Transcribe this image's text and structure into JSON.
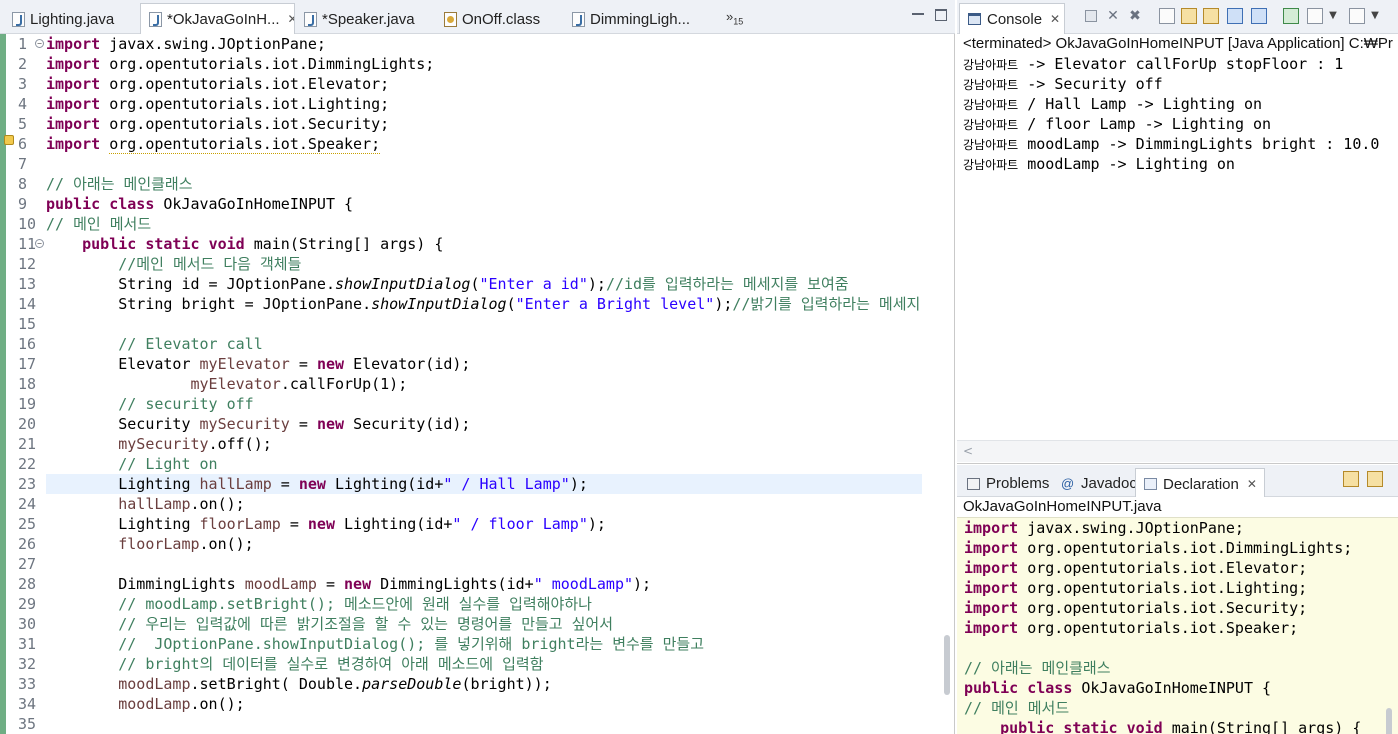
{
  "editor": {
    "tabs": [
      {
        "label": "Lighting.java",
        "icon": "java-file-icon",
        "active": false
      },
      {
        "label": "*OkJavaGoInH...",
        "icon": "java-file-icon",
        "active": true,
        "close": "✕"
      },
      {
        "label": "*Speaker.java",
        "icon": "java-file-icon",
        "active": false
      },
      {
        "label": "OnOff.class",
        "icon": "class-file-icon",
        "active": false
      },
      {
        "label": "DimmingLigh...",
        "icon": "java-file-icon",
        "active": false
      }
    ],
    "overflow_label": "»",
    "overflow_count": "15",
    "lines": [
      {
        "n": "1",
        "fold": "−",
        "segs": [
          [
            "kw",
            "import"
          ],
          [
            "",
            "javax.swing.JOptionPane;"
          ]
        ]
      },
      {
        "n": "2",
        "segs": [
          [
            "kw",
            "import"
          ],
          [
            "",
            "org.opentutorials.iot.DimmingLights;"
          ]
        ]
      },
      {
        "n": "3",
        "segs": [
          [
            "kw",
            "import"
          ],
          [
            "",
            "org.opentutorials.iot.Elevator;"
          ]
        ]
      },
      {
        "n": "4",
        "segs": [
          [
            "kw",
            "import"
          ],
          [
            "",
            "org.opentutorials.iot.Lighting;"
          ]
        ]
      },
      {
        "n": "5",
        "segs": [
          [
            "kw",
            "import"
          ],
          [
            "",
            "org.opentutorials.iot.Security;"
          ]
        ]
      },
      {
        "n": "6",
        "segs": [
          [
            "kw",
            "import"
          ],
          [
            "uline",
            "org.opentutorials.iot.Speaker;"
          ]
        ]
      },
      {
        "n": "7",
        "segs": []
      },
      {
        "n": "8",
        "segs": [
          [
            "cm",
            "// 아래는 메인클래스"
          ]
        ]
      },
      {
        "n": "9",
        "segs": [
          [
            "kw",
            "public"
          ],
          [
            "kw",
            "class"
          ],
          [
            "",
            "OkJavaGoInHomeINPUT {"
          ]
        ]
      },
      {
        "n": "10",
        "segs": [
          [
            "cm",
            "// 메인 메서드"
          ]
        ]
      },
      {
        "n": "11",
        "fold": "−",
        "indent": "    ",
        "segs": [
          [
            "kw",
            "public"
          ],
          [
            "kw",
            "static"
          ],
          [
            "kw",
            "void"
          ],
          [
            "",
            "main(String[] args) {"
          ]
        ]
      },
      {
        "n": "12",
        "indent": "        ",
        "segs": [
          [
            "cm",
            "//메인 메서드 다음 객체들"
          ]
        ]
      },
      {
        "n": "13",
        "indent": "        ",
        "segs": [
          [
            "",
            "String id = JOptionPane."
          ],
          [
            "it",
            "showInputDialog"
          ],
          [
            "",
            "("
          ],
          [
            "str",
            "\"Enter a id\""
          ],
          [
            "",
            ");"
          ],
          [
            "cm",
            "//id를 입력하라는 메세지를 보여줌"
          ]
        ]
      },
      {
        "n": "14",
        "indent": "        ",
        "segs": [
          [
            "",
            "String bright = JOptionPane."
          ],
          [
            "it",
            "showInputDialog"
          ],
          [
            "",
            "("
          ],
          [
            "str",
            "\"Enter a Bright level\""
          ],
          [
            "",
            ");"
          ],
          [
            "cm",
            "//밝기를 입력하라는 메세지"
          ]
        ]
      },
      {
        "n": "15",
        "segs": []
      },
      {
        "n": "16",
        "indent": "        ",
        "segs": [
          [
            "cm",
            "// Elevator call"
          ]
        ]
      },
      {
        "n": "17",
        "indent": "        ",
        "segs": [
          [
            "",
            "Elevator "
          ],
          [
            "fld",
            "myElevator"
          ],
          [
            "",
            " = "
          ],
          [
            "kw",
            "new"
          ],
          [
            "",
            "Elevator(id);"
          ]
        ]
      },
      {
        "n": "18",
        "indent": "                ",
        "segs": [
          [
            "fld",
            "myElevator"
          ],
          [
            "",
            ".callForUp(1);"
          ]
        ]
      },
      {
        "n": "19",
        "indent": "        ",
        "segs": [
          [
            "cm",
            "// security off"
          ]
        ]
      },
      {
        "n": "20",
        "indent": "        ",
        "segs": [
          [
            "",
            "Security "
          ],
          [
            "fld",
            "mySecurity"
          ],
          [
            "",
            " = "
          ],
          [
            "kw",
            "new"
          ],
          [
            "",
            "Security(id);"
          ]
        ]
      },
      {
        "n": "21",
        "indent": "        ",
        "segs": [
          [
            "fld",
            "mySecurity"
          ],
          [
            "",
            ".off();"
          ]
        ]
      },
      {
        "n": "22",
        "indent": "        ",
        "segs": [
          [
            "cm",
            "// Light on"
          ]
        ]
      },
      {
        "n": "23",
        "hl": true,
        "indent": "        ",
        "segs": [
          [
            "",
            "Lighting "
          ],
          [
            "fld",
            "hallLamp"
          ],
          [
            "",
            " = "
          ],
          [
            "kw",
            "new"
          ],
          [
            "",
            "Lighting(id+"
          ],
          [
            "str",
            "\" / Hall Lamp\""
          ],
          [
            "",
            ");"
          ]
        ]
      },
      {
        "n": "24",
        "indent": "        ",
        "segs": [
          [
            "fld",
            "hallLamp"
          ],
          [
            "",
            ".on();"
          ]
        ]
      },
      {
        "n": "25",
        "indent": "        ",
        "segs": [
          [
            "",
            "Lighting "
          ],
          [
            "fld",
            "floorLamp"
          ],
          [
            "",
            " = "
          ],
          [
            "kw",
            "new"
          ],
          [
            "",
            "Lighting(id+"
          ],
          [
            "str",
            "\" / floor Lamp\""
          ],
          [
            "",
            ");"
          ]
        ]
      },
      {
        "n": "26",
        "indent": "        ",
        "segs": [
          [
            "fld",
            "floorLamp"
          ],
          [
            "",
            ".on();"
          ]
        ]
      },
      {
        "n": "27",
        "segs": []
      },
      {
        "n": "28",
        "indent": "        ",
        "segs": [
          [
            "",
            "DimmingLights "
          ],
          [
            "fld",
            "moodLamp"
          ],
          [
            "",
            " = "
          ],
          [
            "kw",
            "new"
          ],
          [
            "",
            "DimmingLights(id+"
          ],
          [
            "str",
            "\" moodLamp\""
          ],
          [
            "",
            ");"
          ]
        ]
      },
      {
        "n": "29",
        "indent": "        ",
        "segs": [
          [
            "cm",
            "// moodLamp.setBright(); 메소드안에 원래 실수를 입력해야하나"
          ]
        ]
      },
      {
        "n": "30",
        "indent": "        ",
        "segs": [
          [
            "cm",
            "// 우리는 입력값에 따른 밝기조절을 할 수 있는 명령어를 만들고 싶어서"
          ]
        ]
      },
      {
        "n": "31",
        "indent": "        ",
        "segs": [
          [
            "cm",
            "//  JOptionPane.showInputDialog(); 를 넣기위해 bright라는 변수를 만들고"
          ]
        ]
      },
      {
        "n": "32",
        "indent": "        ",
        "segs": [
          [
            "cm",
            "// bright의 데이터를 실수로 변경하여 아래 메소드에 입력함"
          ]
        ]
      },
      {
        "n": "33",
        "indent": "        ",
        "segs": [
          [
            "fld",
            "moodLamp"
          ],
          [
            "",
            ".setBright( Double."
          ],
          [
            "it",
            "parseDouble"
          ],
          [
            "",
            "(bright));"
          ]
        ]
      },
      {
        "n": "34",
        "indent": "        ",
        "segs": [
          [
            "fld",
            "moodLamp"
          ],
          [
            "",
            ".on();"
          ]
        ]
      },
      {
        "n": "35",
        "segs": []
      }
    ]
  },
  "console": {
    "tab_label": "Console",
    "tab_close": "✕",
    "terminated": "<terminated> OkJavaGoInHomeINPUT [Java Application] C:₩Pr",
    "output": [
      {
        "pre": "강남아파트",
        "post": " -> Elevator callForUp stopFloor : 1"
      },
      {
        "pre": "강남아파트",
        "post": " -> Security off"
      },
      {
        "pre": "강남아파트",
        "post": " / Hall Lamp -> Lighting on"
      },
      {
        "pre": "강남아파트",
        "post": " / floor Lamp -> Lighting on"
      },
      {
        "pre": "강남아파트",
        "post": " moodLamp -> DimmingLights bright : 10.0"
      },
      {
        "pre": "강남아파트",
        "post": " moodLamp -> Lighting on"
      }
    ],
    "hscroll_arrow": "<"
  },
  "declaration": {
    "tabs": [
      {
        "label": "Problems",
        "icon": "problems-icon"
      },
      {
        "label": "Javadoc",
        "icon": "javadoc-icon",
        "glyph": "@"
      },
      {
        "label": "Declaration",
        "icon": "declaration-icon",
        "active": true,
        "close": "✕"
      }
    ],
    "file_label": "OkJavaGoInHomeINPUT.java",
    "lines": [
      {
        "segs": [
          [
            "kw",
            "import"
          ],
          [
            "",
            "javax.swing.JOptionPane;"
          ]
        ]
      },
      {
        "segs": [
          [
            "kw",
            "import"
          ],
          [
            "",
            "org.opentutorials.iot.DimmingLights;"
          ]
        ]
      },
      {
        "segs": [
          [
            "kw",
            "import"
          ],
          [
            "",
            "org.opentutorials.iot.Elevator;"
          ]
        ]
      },
      {
        "segs": [
          [
            "kw",
            "import"
          ],
          [
            "",
            "org.opentutorials.iot.Lighting;"
          ]
        ]
      },
      {
        "segs": [
          [
            "kw",
            "import"
          ],
          [
            "",
            "org.opentutorials.iot.Security;"
          ]
        ]
      },
      {
        "segs": [
          [
            "kw",
            "import"
          ],
          [
            "",
            "org.opentutorials.iot.Speaker;"
          ]
        ]
      },
      {
        "segs": []
      },
      {
        "segs": [
          [
            "cm",
            "// 아래는 메인클래스"
          ]
        ]
      },
      {
        "segs": [
          [
            "kw",
            "public"
          ],
          [
            "kw",
            "class"
          ],
          [
            "",
            "OkJavaGoInHomeINPUT {"
          ]
        ]
      },
      {
        "segs": [
          [
            "cm",
            "// 메인 메서드"
          ]
        ]
      },
      {
        "indent": "    ",
        "segs": [
          [
            "kw",
            "public"
          ],
          [
            "kw",
            "static"
          ],
          [
            "kw",
            "void"
          ],
          [
            "",
            "main(String[] args) {"
          ]
        ]
      }
    ]
  }
}
